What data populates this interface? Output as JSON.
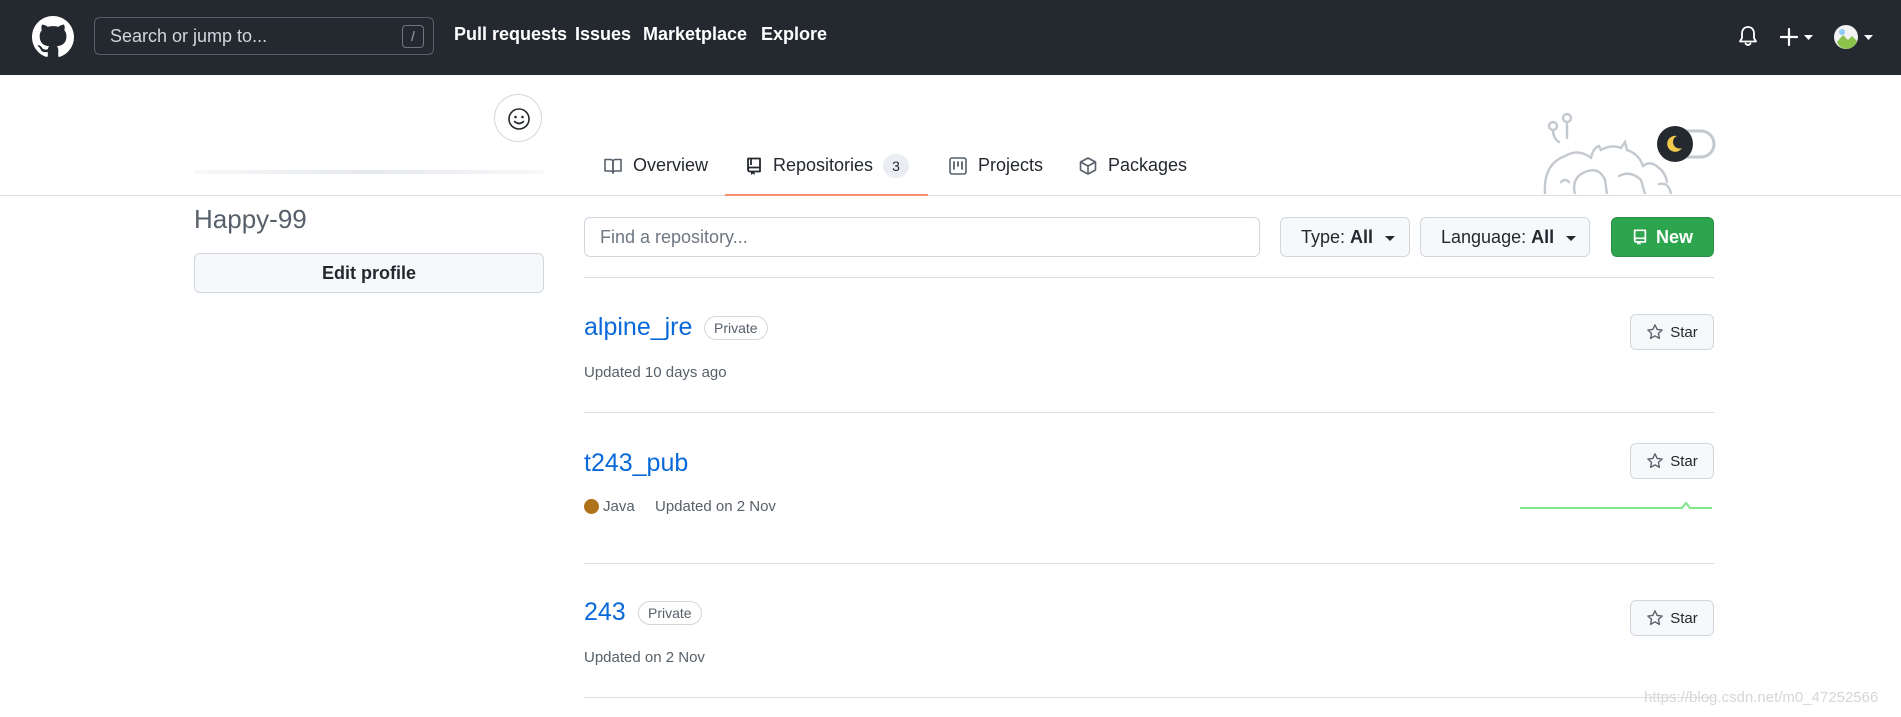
{
  "header": {
    "search_placeholder": "Search or jump to...",
    "search_shortcut": "/",
    "nav": [
      "Pull requests",
      "Issues",
      "Marketplace",
      "Explore"
    ]
  },
  "profile": {
    "username": "Happy-99",
    "edit_profile_label": "Edit profile"
  },
  "tabs": {
    "overview": "Overview",
    "repositories": "Repositories",
    "repositories_count": "3",
    "projects": "Projects",
    "packages": "Packages"
  },
  "filters": {
    "search_placeholder": "Find a repository...",
    "type_label": "Type:",
    "type_value": "All",
    "language_label": "Language:",
    "language_value": "All",
    "new_label": "New"
  },
  "repos": [
    {
      "name": "alpine_jre",
      "visibility": "Private",
      "updated": "Updated 10 days ago",
      "star_label": "Star"
    },
    {
      "name": "t243_pub",
      "language": "Java",
      "language_color": "#b07219",
      "updated": "Updated on 2 Nov",
      "star_label": "Star"
    },
    {
      "name": "243",
      "visibility": "Private",
      "updated": "Updated on 2 Nov",
      "star_label": "Star"
    }
  ],
  "colors": {
    "header_bg": "#24292f",
    "link": "#0969da",
    "primary_button": "#2da44e",
    "active_tab_underline": "#fd8c73"
  },
  "watermark": "https://blog.csdn.net/m0_47252566"
}
